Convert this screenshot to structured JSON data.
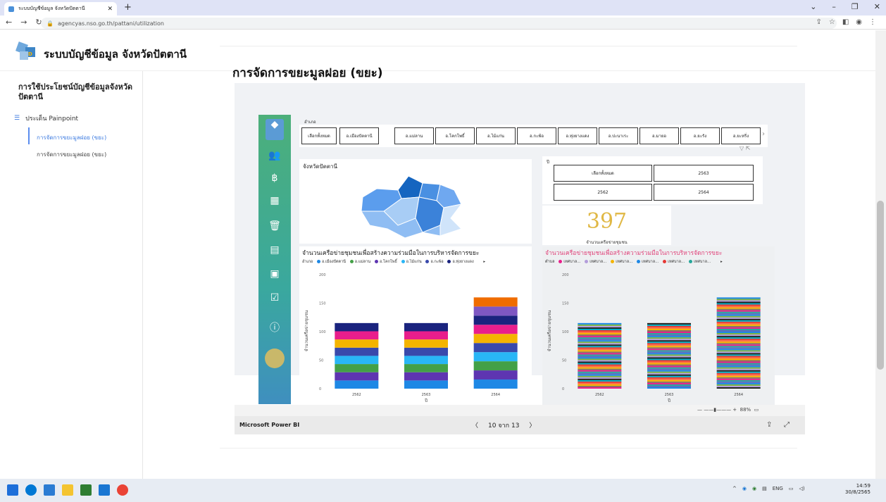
{
  "browser": {
    "tab_title": "ระบบบัญชีข้อมูล จังหวัดปัตตานี",
    "url": "agencyas.nso.go.th/pattani/utilization"
  },
  "site": {
    "title": "ระบบบัญชีข้อมูล จังหวัดปัตตานี"
  },
  "sidebar": {
    "heading": "การใช้ประโยชน์บัญชีข้อมูลจังหวัดปัตตานี",
    "group": "ประเด็น Painpoint",
    "items": [
      {
        "label": "การจัดการขยะมูลฝอย (ขยะ)"
      },
      {
        "label": "การจัดการขยะมูลฝอย (ขยะ)"
      }
    ]
  },
  "page": {
    "title": "การจัดการขยะมูลฝอย (ขยะ)"
  },
  "report": {
    "filter_label": "อำเภอ",
    "filters": [
      "เลือกทั้งหมด",
      "อ.เมืองปัตตานี",
      "อ.แม่ลาน",
      "อ.โคกโพธิ์",
      "อ.ไม้แก่น",
      "อ.กะพ้อ",
      "อ.ทุ่งยางแดง",
      "อ.ปะนาเระ",
      "อ.มายอ",
      "อ.ยะรัง",
      "อ.ยะหริ่ง"
    ],
    "map_title": "จังหวัดปัตตานี",
    "year_label": "ปี",
    "years": [
      "เลือกทั้งหมด",
      "2563",
      "2562",
      "2564"
    ],
    "kpi_value": "397",
    "kpi_label": "จำนวนเครือข่ายชุมชน",
    "chart1": {
      "title": "จำนวนเครือข่ายชุมชนเพื่อสร้างความร่วมมือในการบริหารจัดการขยะ",
      "legend_label": "อำเภอ",
      "legend": [
        "อ.เมืองปัตตานี",
        "อ.แม่ลาน",
        "อ.โคกโพธิ์",
        "อ.ไม้แก่น",
        "อ.กะพ้อ",
        "อ.ทุ่งยางแดง"
      ]
    },
    "chart2": {
      "title": "จำนวนเครือข่ายชุมชนเพื่อสร้างความร่วมมือในการบริหารจัดการขยะ",
      "legend_label": "ตำบล",
      "legend": [
        "เทศบาล...",
        "เทศบาล...",
        "เทศบาล...",
        "เทศบาล...",
        "เทศบาล...",
        "เทศบาล..."
      ]
    },
    "ylabel": "จำนวนเครือข่ายชุมชน",
    "xlabel": "ปี",
    "pbi_label": "Microsoft Power BI",
    "pager": "10 จาก 13",
    "zoom": "88%"
  },
  "chart_data": [
    {
      "type": "bar",
      "title": "จำนวนเครือข่ายชุมชนเพื่อสร้างความร่วมมือในการบริหารจัดการขยะ",
      "categories": [
        "2562",
        "2563",
        "2564"
      ],
      "totals": [
        115,
        115,
        160
      ],
      "ylim": [
        0,
        200
      ],
      "yticks": [
        0,
        50,
        100,
        150,
        200
      ],
      "ylabel": "จำนวนเครือข่ายชุมชน",
      "xlabel": "ปี",
      "stack_colors": [
        "#1e88e5",
        "#5e35b1",
        "#43a047",
        "#29b6f6",
        "#3949ab",
        "#f4b400",
        "#e91e8c",
        "#1a237e",
        "#7e57c2",
        "#ef6c00"
      ],
      "stacked": true
    },
    {
      "type": "bar",
      "title": "จำนวนเครือข่ายชุมชนเพื่อสร้างความร่วมมือในการบริหารจัดการขยะ",
      "categories": [
        "2562",
        "2563",
        "2564"
      ],
      "totals": [
        115,
        115,
        160
      ],
      "ylim": [
        0,
        200
      ],
      "yticks": [
        0,
        50,
        100,
        150,
        200
      ],
      "ylabel": "จำนวนเครือข่ายชุมชน",
      "xlabel": "ปี",
      "stacked": true
    }
  ],
  "taskbar": {
    "lang": "ENG",
    "time": "14:59",
    "date": "30/8/2565"
  }
}
